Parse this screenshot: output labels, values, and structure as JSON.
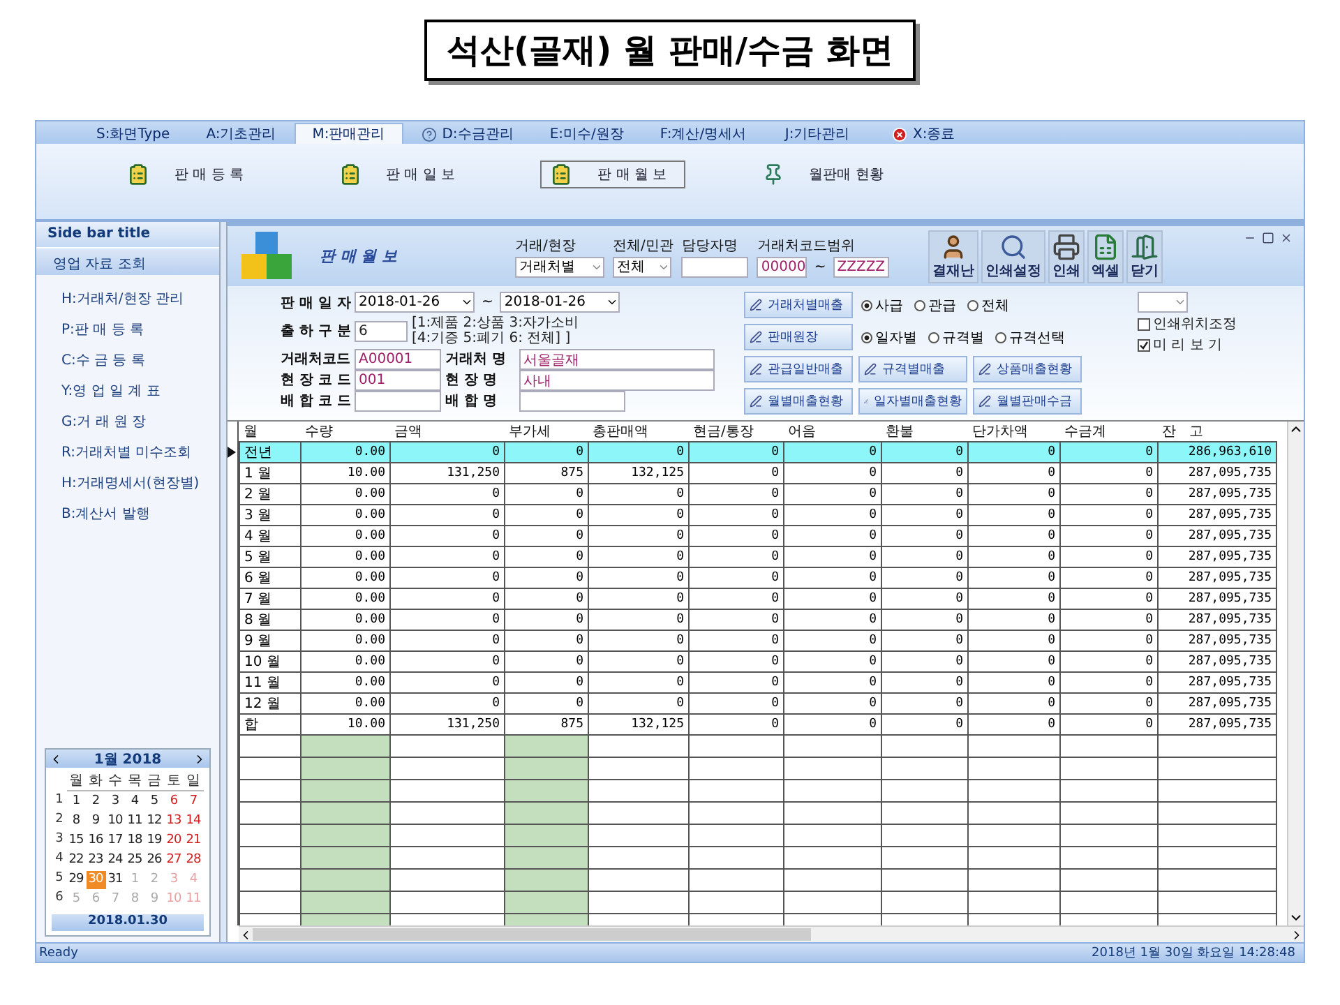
{
  "title": "석산(골재) 월 판매/수금 화면",
  "menu_tabs": [
    {
      "label": "S:화면Type",
      "selected": false
    },
    {
      "label": "A:기초관리",
      "selected": false
    },
    {
      "label": "M:판매관리",
      "selected": true
    },
    {
      "label": "D:수금관리",
      "selected": false
    },
    {
      "label": "E:미수/원장",
      "selected": false
    },
    {
      "label": "F:계산/명세서",
      "selected": false
    },
    {
      "label": "J:기타관리",
      "selected": false
    },
    {
      "label": "X:종료",
      "selected": false
    }
  ],
  "ribbon": [
    {
      "label": "판 매 등 록",
      "selected": false
    },
    {
      "label": "판 매 일 보",
      "selected": false
    },
    {
      "label": "판 매 월 보",
      "selected": true
    },
    {
      "label": "월판매 현황",
      "selected": false
    }
  ],
  "sidebar": {
    "title": "Side bar title",
    "section": "영업 자료 조회",
    "items": [
      "H:거래처/현장 관리",
      "P:판 매 등 록",
      "C:수 금 등 록",
      "Y:영 업 일 계 표",
      "G:거 래 원 장",
      "R:거래처별 미수조회",
      "H:거래명세서(현장별)",
      "B:계산서 발행"
    ]
  },
  "calendar": {
    "month": "1월 2018",
    "weekdays": [
      "월",
      "화",
      "수",
      "목",
      "금",
      "토",
      "일"
    ],
    "footer": "2018.01.30",
    "weeks": [
      {
        "week": "1",
        "days": [
          {
            "d": "1",
            "kind": "day",
            "selected": false
          },
          {
            "d": "2",
            "kind": "day",
            "selected": false
          },
          {
            "d": "3",
            "kind": "day",
            "selected": false
          },
          {
            "d": "4",
            "kind": "day",
            "selected": false
          },
          {
            "d": "5",
            "kind": "day",
            "selected": false
          },
          {
            "d": "6",
            "kind": "weekend",
            "selected": false
          },
          {
            "d": "7",
            "kind": "weekend",
            "selected": false
          }
        ]
      },
      {
        "week": "2",
        "days": [
          {
            "d": "8",
            "kind": "day",
            "selected": false
          },
          {
            "d": "9",
            "kind": "day",
            "selected": false
          },
          {
            "d": "10",
            "kind": "day",
            "selected": false
          },
          {
            "d": "11",
            "kind": "day",
            "selected": false
          },
          {
            "d": "12",
            "kind": "day",
            "selected": false
          },
          {
            "d": "13",
            "kind": "weekend",
            "selected": false
          },
          {
            "d": "14",
            "kind": "weekend",
            "selected": false
          }
        ]
      },
      {
        "week": "3",
        "days": [
          {
            "d": "15",
            "kind": "day",
            "selected": false
          },
          {
            "d": "16",
            "kind": "day",
            "selected": false
          },
          {
            "d": "17",
            "kind": "day",
            "selected": false
          },
          {
            "d": "18",
            "kind": "day",
            "selected": false
          },
          {
            "d": "19",
            "kind": "day",
            "selected": false
          },
          {
            "d": "20",
            "kind": "weekend",
            "selected": false
          },
          {
            "d": "21",
            "kind": "weekend",
            "selected": false
          }
        ]
      },
      {
        "week": "4",
        "days": [
          {
            "d": "22",
            "kind": "day",
            "selected": false
          },
          {
            "d": "23",
            "kind": "day",
            "selected": false
          },
          {
            "d": "24",
            "kind": "day",
            "selected": false
          },
          {
            "d": "25",
            "kind": "day",
            "selected": false
          },
          {
            "d": "26",
            "kind": "day",
            "selected": false
          },
          {
            "d": "27",
            "kind": "weekend",
            "selected": false
          },
          {
            "d": "28",
            "kind": "weekend",
            "selected": false
          }
        ]
      },
      {
        "week": "5",
        "days": [
          {
            "d": "29",
            "kind": "day",
            "selected": false
          },
          {
            "d": "30",
            "kind": "day",
            "selected": true
          },
          {
            "d": "31",
            "kind": "day",
            "selected": false
          },
          {
            "d": "1",
            "kind": "other",
            "selected": false
          },
          {
            "d": "2",
            "kind": "other",
            "selected": false
          },
          {
            "d": "3",
            "kind": "other_weekend",
            "selected": false
          },
          {
            "d": "4",
            "kind": "other_weekend",
            "selected": false
          }
        ]
      },
      {
        "week": "6",
        "days": [
          {
            "d": "5",
            "kind": "other",
            "selected": false
          },
          {
            "d": "6",
            "kind": "other",
            "selected": false
          },
          {
            "d": "7",
            "kind": "other",
            "selected": false
          },
          {
            "d": "8",
            "kind": "other",
            "selected": false
          },
          {
            "d": "9",
            "kind": "other",
            "selected": false
          },
          {
            "d": "10",
            "kind": "other_weekend",
            "selected": false
          },
          {
            "d": "11",
            "kind": "other_weekend",
            "selected": false
          }
        ]
      }
    ]
  },
  "panel": {
    "title": "판 매 월 보",
    "filters": [
      {
        "label": "거래/현장",
        "kind": "select",
        "value": "거래처별"
      },
      {
        "label": "전체/민관",
        "kind": "select",
        "value": "전체"
      },
      {
        "label": "담당자명",
        "kind": "text"
      },
      {
        "label": "거래처코드범위",
        "kind": "range",
        "from": "00000",
        "separator": "~",
        "to": "ZZZZZ"
      }
    ],
    "toolbar": [
      "결재난",
      "인쇄설정",
      "인쇄",
      "엑셀",
      "닫기"
    ]
  },
  "form": {
    "date": {
      "label": "판 매 일 자",
      "from": "2018-01-26",
      "separator": "~",
      "to": "2018-01-26"
    },
    "shipping": {
      "label": "출 하 구 분",
      "value": "6",
      "note_lines": [
        "[1:제품 2:상품 3:자가소비",
        "[4:기증 5:폐기 6: 전체] ]"
      ]
    },
    "pairs": [
      {
        "code_label": "거래처코드",
        "code": "A00001",
        "name_label": "거래처 명",
        "name": "서울골재"
      },
      {
        "code_label": "현 장 코 드",
        "code": "001",
        "name_label": "현 장 명",
        "name": "사내"
      },
      {
        "code_label": "배 합 코 드",
        "name_label": "배 합 명"
      }
    ],
    "report_rows": [
      {
        "buttons": [
          "거래처별매출"
        ],
        "radios": [
          {
            "label": "사급",
            "selected": true
          },
          {
            "label": "관급",
            "selected": false
          },
          {
            "label": "전체",
            "selected": false
          }
        ]
      },
      {
        "buttons": [
          "판매원장"
        ],
        "radios": [
          {
            "label": "일자별",
            "selected": true
          },
          {
            "label": "규격별",
            "selected": false
          },
          {
            "label": "규격선택",
            "selected": false
          }
        ]
      },
      {
        "buttons": [
          "관급일반매출",
          "규격별매출",
          "상품매출현황"
        ]
      },
      {
        "buttons": [
          "월별매출현황",
          "일자별매출현황",
          "월별판매수금"
        ]
      }
    ],
    "checkboxes": [
      {
        "label": "인쇄위치조정",
        "checked": false
      },
      {
        "label": "미 리 보 기",
        "checked": true
      }
    ]
  },
  "table": {
    "columns": [
      "월",
      "수량",
      "금액",
      "부가세",
      "총판매액",
      "현금/통장",
      "어음",
      "환불",
      "단가차액",
      "수금계",
      "잔   고"
    ],
    "rows": [
      {
        "selected": true,
        "cells": [
          "전년",
          "0.00",
          "0",
          "0",
          "0",
          "0",
          "0",
          "0",
          "0",
          "0",
          "286,963,610"
        ]
      },
      {
        "selected": false,
        "cells": [
          "1 월",
          "10.00",
          "131,250",
          "875",
          "132,125",
          "0",
          "0",
          "0",
          "0",
          "0",
          "287,095,735"
        ]
      },
      {
        "selected": false,
        "cells": [
          "2 월",
          "0.00",
          "0",
          "0",
          "0",
          "0",
          "0",
          "0",
          "0",
          "0",
          "287,095,735"
        ]
      },
      {
        "selected": false,
        "cells": [
          "3 월",
          "0.00",
          "0",
          "0",
          "0",
          "0",
          "0",
          "0",
          "0",
          "0",
          "287,095,735"
        ]
      },
      {
        "selected": false,
        "cells": [
          "4 월",
          "0.00",
          "0",
          "0",
          "0",
          "0",
          "0",
          "0",
          "0",
          "0",
          "287,095,735"
        ]
      },
      {
        "selected": false,
        "cells": [
          "5 월",
          "0.00",
          "0",
          "0",
          "0",
          "0",
          "0",
          "0",
          "0",
          "0",
          "287,095,735"
        ]
      },
      {
        "selected": false,
        "cells": [
          "6 월",
          "0.00",
          "0",
          "0",
          "0",
          "0",
          "0",
          "0",
          "0",
          "0",
          "287,095,735"
        ]
      },
      {
        "selected": false,
        "cells": [
          "7 월",
          "0.00",
          "0",
          "0",
          "0",
          "0",
          "0",
          "0",
          "0",
          "0",
          "287,095,735"
        ]
      },
      {
        "selected": false,
        "cells": [
          "8 월",
          "0.00",
          "0",
          "0",
          "0",
          "0",
          "0",
          "0",
          "0",
          "0",
          "287,095,735"
        ]
      },
      {
        "selected": false,
        "cells": [
          "9 월",
          "0.00",
          "0",
          "0",
          "0",
          "0",
          "0",
          "0",
          "0",
          "0",
          "287,095,735"
        ]
      },
      {
        "selected": false,
        "cells": [
          "10 월",
          "0.00",
          "0",
          "0",
          "0",
          "0",
          "0",
          "0",
          "0",
          "0",
          "287,095,735"
        ]
      },
      {
        "selected": false,
        "cells": [
          "11 월",
          "0.00",
          "0",
          "0",
          "0",
          "0",
          "0",
          "0",
          "0",
          "0",
          "287,095,735"
        ]
      },
      {
        "selected": false,
        "cells": [
          "12 월",
          "0.00",
          "0",
          "0",
          "0",
          "0",
          "0",
          "0",
          "0",
          "0",
          "287,095,735"
        ]
      },
      {
        "selected": false,
        "cells": [
          "합",
          "10.00",
          "131,250",
          "875",
          "132,125",
          "0",
          "0",
          "0",
          "0",
          "0",
          "287,095,735"
        ]
      }
    ]
  },
  "status_bar": {
    "left": "Ready",
    "right": "2018년 1월 30일 화요일 14:28:48"
  }
}
